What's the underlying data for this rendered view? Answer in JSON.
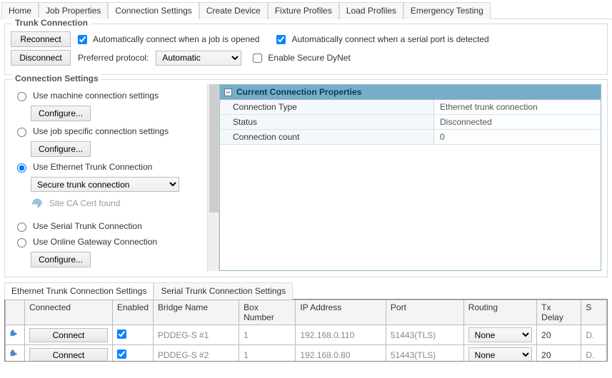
{
  "tabs": {
    "items": [
      "Home",
      "Job Properties",
      "Connection Settings",
      "Create Device",
      "Fixture Profiles",
      "Load Profiles",
      "Emergency Testing"
    ],
    "active_index": 2
  },
  "trunk": {
    "title": "Trunk Connection",
    "reconnect": "Reconnect",
    "disconnect": "Disconnect",
    "auto_job_label": "Automatically connect when a job is opened",
    "auto_job_checked": true,
    "auto_serial_label": "Automatically connect when a serial port is detected",
    "auto_serial_checked": true,
    "pref_proto_label": "Preferred protocol:",
    "pref_proto_value": "Automatic",
    "enable_secure_label": "Enable Secure DyNet",
    "enable_secure_checked": false
  },
  "conn": {
    "title": "Connection Settings",
    "radios": {
      "machine": "Use machine connection settings",
      "job": "Use job specific connection settings",
      "eth": "Use Ethernet Trunk Connection",
      "serial": "Use Serial Trunk Connection",
      "gateway": "Use Online Gateway Connection",
      "selected": "eth"
    },
    "configure": "Configure...",
    "eth_mode": "Secure trunk connection",
    "cert_text": "Site CA Cert found"
  },
  "props": {
    "title": "Current Connection Properties",
    "rows": [
      {
        "k": "Connection Type",
        "v": "Ethernet trunk connection"
      },
      {
        "k": "Status",
        "v": "Disconnected"
      },
      {
        "k": "Connection count",
        "v": "0"
      }
    ]
  },
  "bottom_tabs": {
    "items": [
      "Ethernet Trunk Connection Settings",
      "Serial Trunk Connection Settings"
    ],
    "active_index": 0
  },
  "grid": {
    "cols": [
      "",
      "Connected",
      "Enabled",
      "Bridge Name",
      "Box Number",
      "IP Address",
      "Port",
      "Routing",
      "Tx Delay",
      "S"
    ],
    "rows": [
      {
        "connect": "Connect",
        "enabled": true,
        "bridge": "PDDEG-S #1",
        "box": "1",
        "ip": "192.168.0.110",
        "port": "51443(TLS)",
        "routing": "None",
        "tx": "20",
        "s": "D."
      },
      {
        "connect": "Connect",
        "enabled": true,
        "bridge": "PDDEG-S #2",
        "box": "1",
        "ip": "192.168.0.80",
        "port": "51443(TLS)",
        "routing": "None",
        "tx": "20",
        "s": "D."
      }
    ]
  }
}
